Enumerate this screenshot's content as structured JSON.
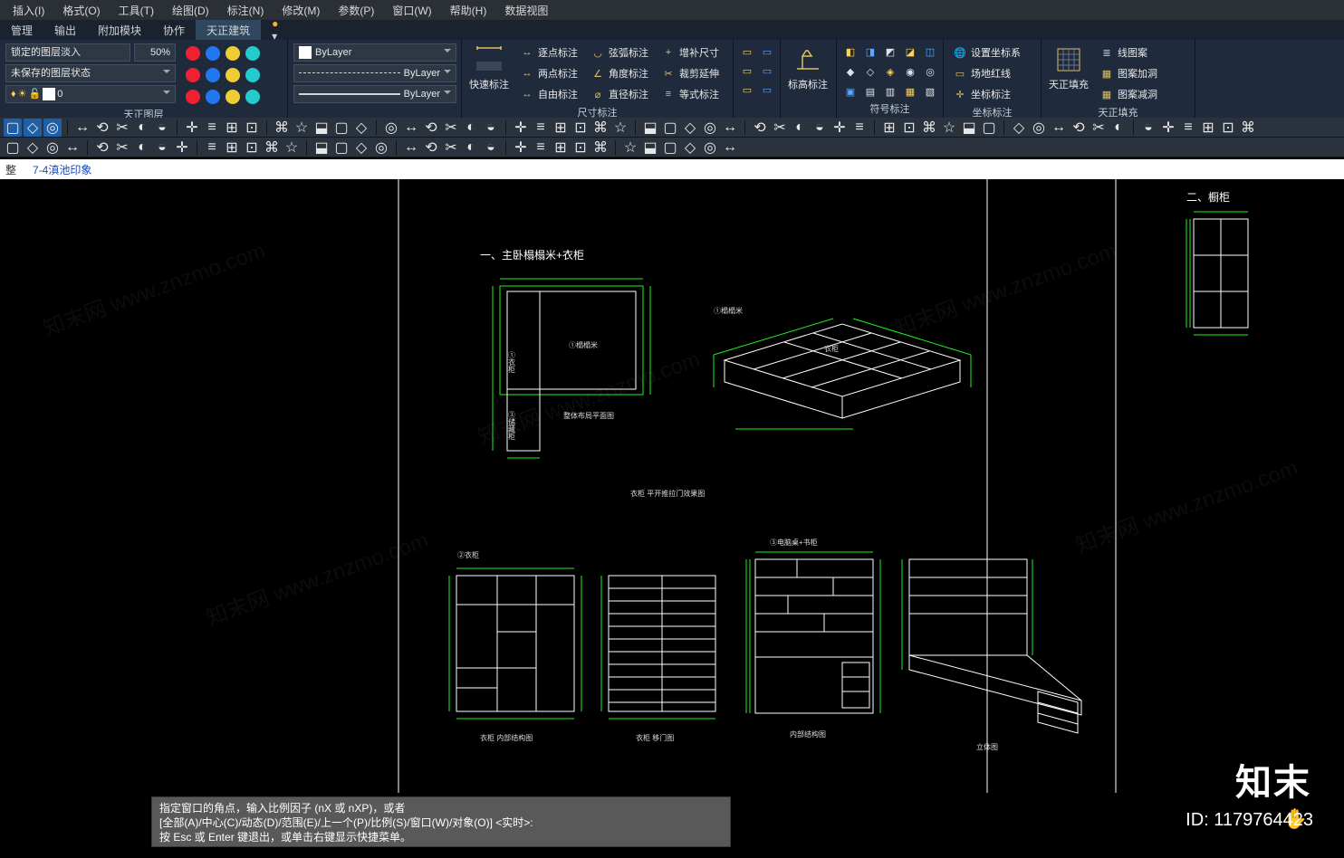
{
  "menu": [
    "插入(I)",
    "格式(O)",
    "工具(T)",
    "绘图(D)",
    "标注(N)",
    "修改(M)",
    "参数(P)",
    "窗口(W)",
    "帮助(H)",
    "数据视图"
  ],
  "tabs": [
    "管理",
    "输出",
    "附加模块",
    "协作",
    "天正建筑"
  ],
  "ribbon": {
    "layer": {
      "locked_fade_label": "锁定的图层淡入",
      "locked_fade_value": "50%",
      "layer_state": "未保存的图层状态",
      "layer_current": "0",
      "title": "天正图层"
    },
    "props": {
      "by_layer": "ByLayer"
    },
    "quickdim": {
      "big": "快速标注",
      "items": [
        "逐点标注",
        "两点标注",
        "自由标注",
        "弦弧标注",
        "角度标注",
        "直径标注",
        "增补尺寸",
        "裁剪延伸",
        "等式标注"
      ],
      "title": "尺寸标注"
    },
    "elev": {
      "big": "标高标注"
    },
    "symbol": {
      "title": "符号标注"
    },
    "coord": {
      "items": [
        "设置坐标系",
        "场地红线",
        "坐标标注"
      ],
      "title": "坐标标注"
    },
    "fill": {
      "big": "天正填充",
      "items": [
        "线图案",
        "图案加洞",
        "图案减洞"
      ],
      "title": "天正填充"
    }
  },
  "doc_tabs": {
    "trunc": "整",
    "tab": "7-4滇池印象"
  },
  "drawing": {
    "title1": "一、主卧榻榻米+衣柜",
    "title2": "二、橱柜",
    "tatami_label": "①榻榻米",
    "tatami_label2": "①榻榻米",
    "wardrobe_small": "①衣柜",
    "storage_small": "③储藏柜",
    "plan_caption": "整体布局平面图",
    "wardrobe_caption": "衣柜 平开推拉门效果图",
    "wardrobe_num": "②衣柜",
    "elev1": "衣柜 内部结构图",
    "elev2": "衣柜 移门图",
    "desk_title": "③电脑桌+书柜",
    "desk_elev": "内部结构图",
    "desk_iso": "立体图"
  },
  "cmd": {
    "l1": "指定窗口的角点，输入比例因子 (nX 或 nXP)，或者",
    "l2": "[全部(A)/中心(C)/动态(D)/范围(E)/上一个(P)/比例(S)/窗口(W)/对象(O)] <实时>:",
    "l3": "按 Esc 或 Enter 键退出，或单击右键显示快捷菜单。"
  },
  "wm": {
    "brand": "知末",
    "id": "ID: 1179764423",
    "tile": "知末网 www.znzmo.com"
  }
}
